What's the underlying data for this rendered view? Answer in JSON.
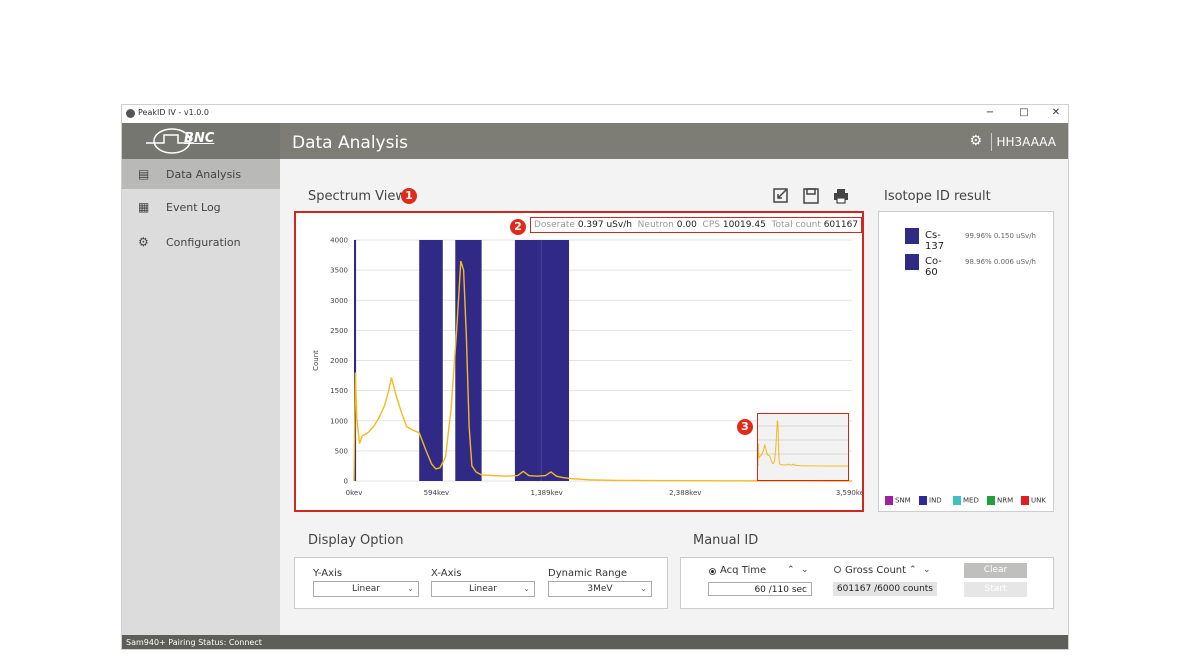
{
  "window": {
    "title": "PeakID IV - v1.0.0",
    "controls": {
      "minimize": "−",
      "maximize": "□",
      "close": "✕"
    }
  },
  "logo": {
    "text": "BNC"
  },
  "header": {
    "title": "Data Analysis",
    "user": "HH3AAAA",
    "settings_icon": "gear-icon"
  },
  "sidebar": {
    "items": [
      {
        "label": "Data Analysis",
        "icon": "chart-icon",
        "active": true
      },
      {
        "label": "Event Log",
        "icon": "calendar-icon",
        "active": false
      },
      {
        "label": "Configuration",
        "icon": "gear-icon",
        "active": false
      }
    ]
  },
  "spectrum": {
    "title": "Spectrum View",
    "toolbar_icons": [
      "export-icon",
      "save-icon",
      "print-icon"
    ],
    "markers": [
      "1",
      "2",
      "3"
    ],
    "stats": {
      "doserate_label": "Doserate",
      "doserate_value": "0.397 uSv/h",
      "neutron_label": "Neutron",
      "neutron_value": "0.00",
      "cps_label": "CPS",
      "cps_value": "10019.45",
      "total_label": "Total count",
      "total_value": "601167"
    }
  },
  "chart_data": {
    "type": "line",
    "title": "",
    "xlabel": "",
    "ylabel": "Count",
    "ylim": [
      0,
      4000
    ],
    "xlim": [
      0,
      3590
    ],
    "yticks": [
      "0",
      "500",
      "1000",
      "1500",
      "2000",
      "2500",
      "3000",
      "3500",
      "4000"
    ],
    "xticks": [
      {
        "value": 0,
        "label": "0kev"
      },
      {
        "value": 594,
        "label": "594kev"
      },
      {
        "value": 1389,
        "label": "1,389kev"
      },
      {
        "value": 2388,
        "label": "2,388kev"
      },
      {
        "value": 3590,
        "label": "3,590kev"
      }
    ],
    "line_color": "#f5b920",
    "band_color": "#302a86",
    "bands": [
      {
        "x0": 0,
        "x1": 15
      },
      {
        "x0": 470,
        "x1": 640
      },
      {
        "x0": 730,
        "x1": 920
      },
      {
        "x0": 1160,
        "x1": 1350
      },
      {
        "x0": 1350,
        "x1": 1550
      }
    ],
    "series": [
      {
        "x": [
          0,
          10,
          20,
          40,
          60,
          100,
          140,
          180,
          220,
          250,
          270,
          300,
          340,
          380,
          420,
          470,
          520,
          560,
          590,
          620,
          660,
          700,
          740,
          770,
          790,
          810,
          830,
          850,
          880,
          920,
          1000,
          1100,
          1180,
          1220,
          1260,
          1320,
          1380,
          1420,
          1460,
          1500,
          1560,
          1700,
          1900,
          2100,
          2400,
          2700,
          3000,
          3300,
          3590
        ],
        "y": [
          0,
          1800,
          1050,
          620,
          750,
          800,
          900,
          1050,
          1250,
          1500,
          1720,
          1450,
          1150,
          900,
          850,
          800,
          500,
          280,
          200,
          220,
          400,
          1200,
          2500,
          3650,
          3500,
          2400,
          900,
          250,
          150,
          100,
          90,
          80,
          90,
          160,
          90,
          80,
          90,
          150,
          80,
          60,
          40,
          20,
          10,
          8,
          5,
          3,
          2,
          1,
          0
        ]
      }
    ]
  },
  "isotope": {
    "title": "Isotope ID result",
    "results": [
      {
        "name": "Cs-137",
        "detail": "99.96% 0.150 uSv/h",
        "color": "#302a86"
      },
      {
        "name": "Co-60",
        "detail": "98.96% 0.006 uSv/h",
        "color": "#302a86"
      }
    ],
    "legend": [
      {
        "label": "SNM",
        "color": "#a020a0"
      },
      {
        "label": "IND",
        "color": "#2a2a9a"
      },
      {
        "label": "MED",
        "color": "#40c0c0"
      },
      {
        "label": "NRM",
        "color": "#20a040"
      },
      {
        "label": "UNK",
        "color": "#e02020"
      }
    ]
  },
  "display_option": {
    "title": "Display Option",
    "y_axis": {
      "label": "Y-Axis",
      "value": "Linear"
    },
    "x_axis": {
      "label": "X-Axis",
      "value": "Linear"
    },
    "dynamic_range": {
      "label": "Dynamic Range",
      "value": "3MeV"
    }
  },
  "manual_id": {
    "title": "Manual ID",
    "acq_time": {
      "label": "Acq Time",
      "value": "60 /110 sec",
      "selected": true
    },
    "gross_count": {
      "label": "Gross Count",
      "value": "601167 /6000 counts",
      "selected": false
    },
    "clear_label": "Clear",
    "start_label": "Start"
  },
  "status": {
    "text": "Sam940+ Pairing Status:  Connect"
  }
}
